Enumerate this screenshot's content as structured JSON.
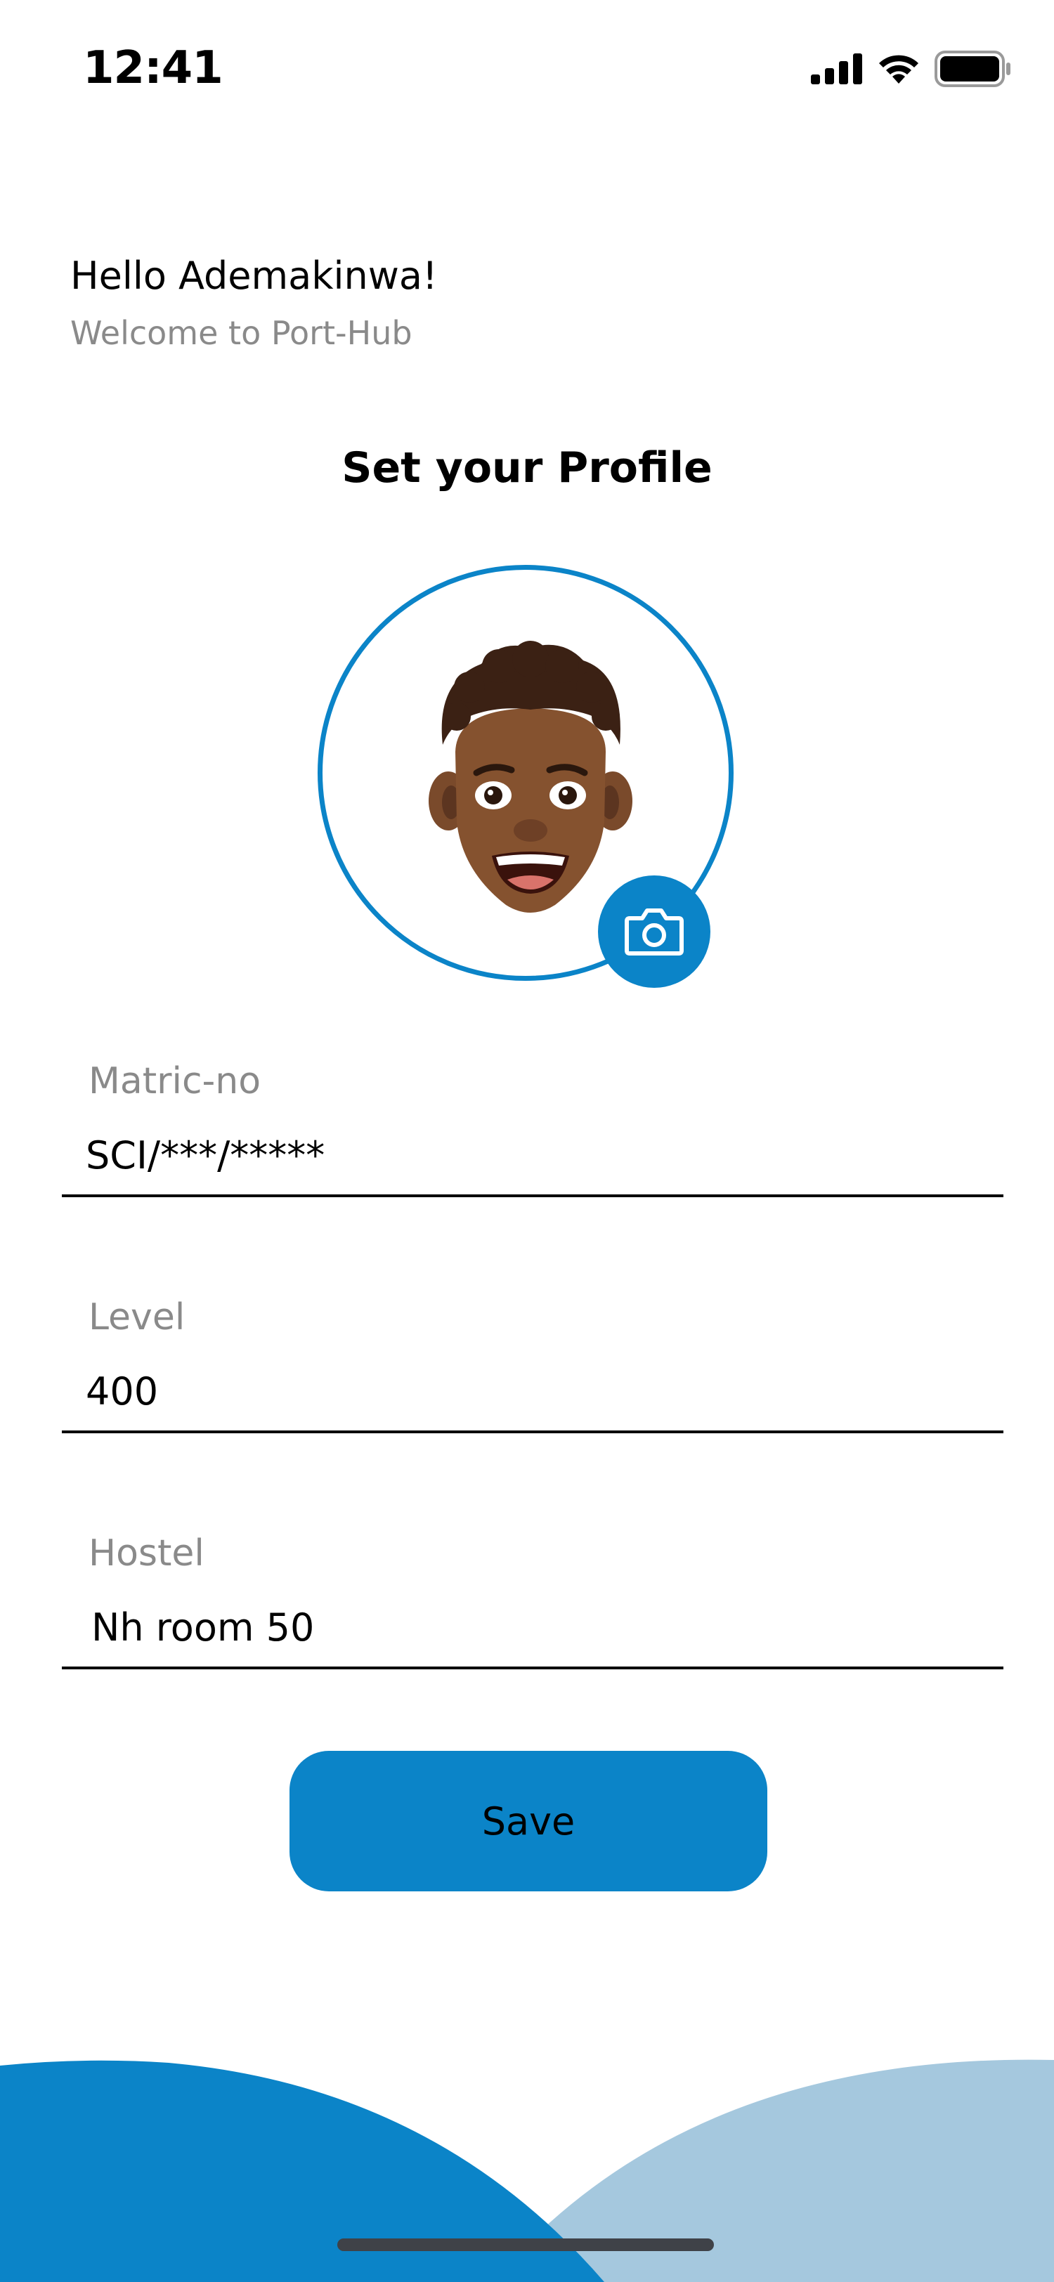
{
  "status_bar": {
    "time": "12:41",
    "icons": [
      "signal-icon",
      "wifi-icon",
      "battery-icon"
    ]
  },
  "header": {
    "greeting": "Hello Ademakinwa!",
    "welcome": "Welcome to Port-Hub"
  },
  "profile": {
    "title": "Set your Profile",
    "avatar": "memoji-avatar",
    "camera_icon": "camera-icon"
  },
  "form": {
    "matric": {
      "label": "Matric-no",
      "value": "SCI/***/*****"
    },
    "level": {
      "label": "Level",
      "value": "400"
    },
    "hostel": {
      "label": "Hostel",
      "value": "Nh room 50"
    }
  },
  "actions": {
    "save_label": "Save"
  },
  "colors": {
    "accent": "#0b84c8",
    "accent_light": "#a5c8de",
    "label_gray": "#8a8a8a"
  }
}
